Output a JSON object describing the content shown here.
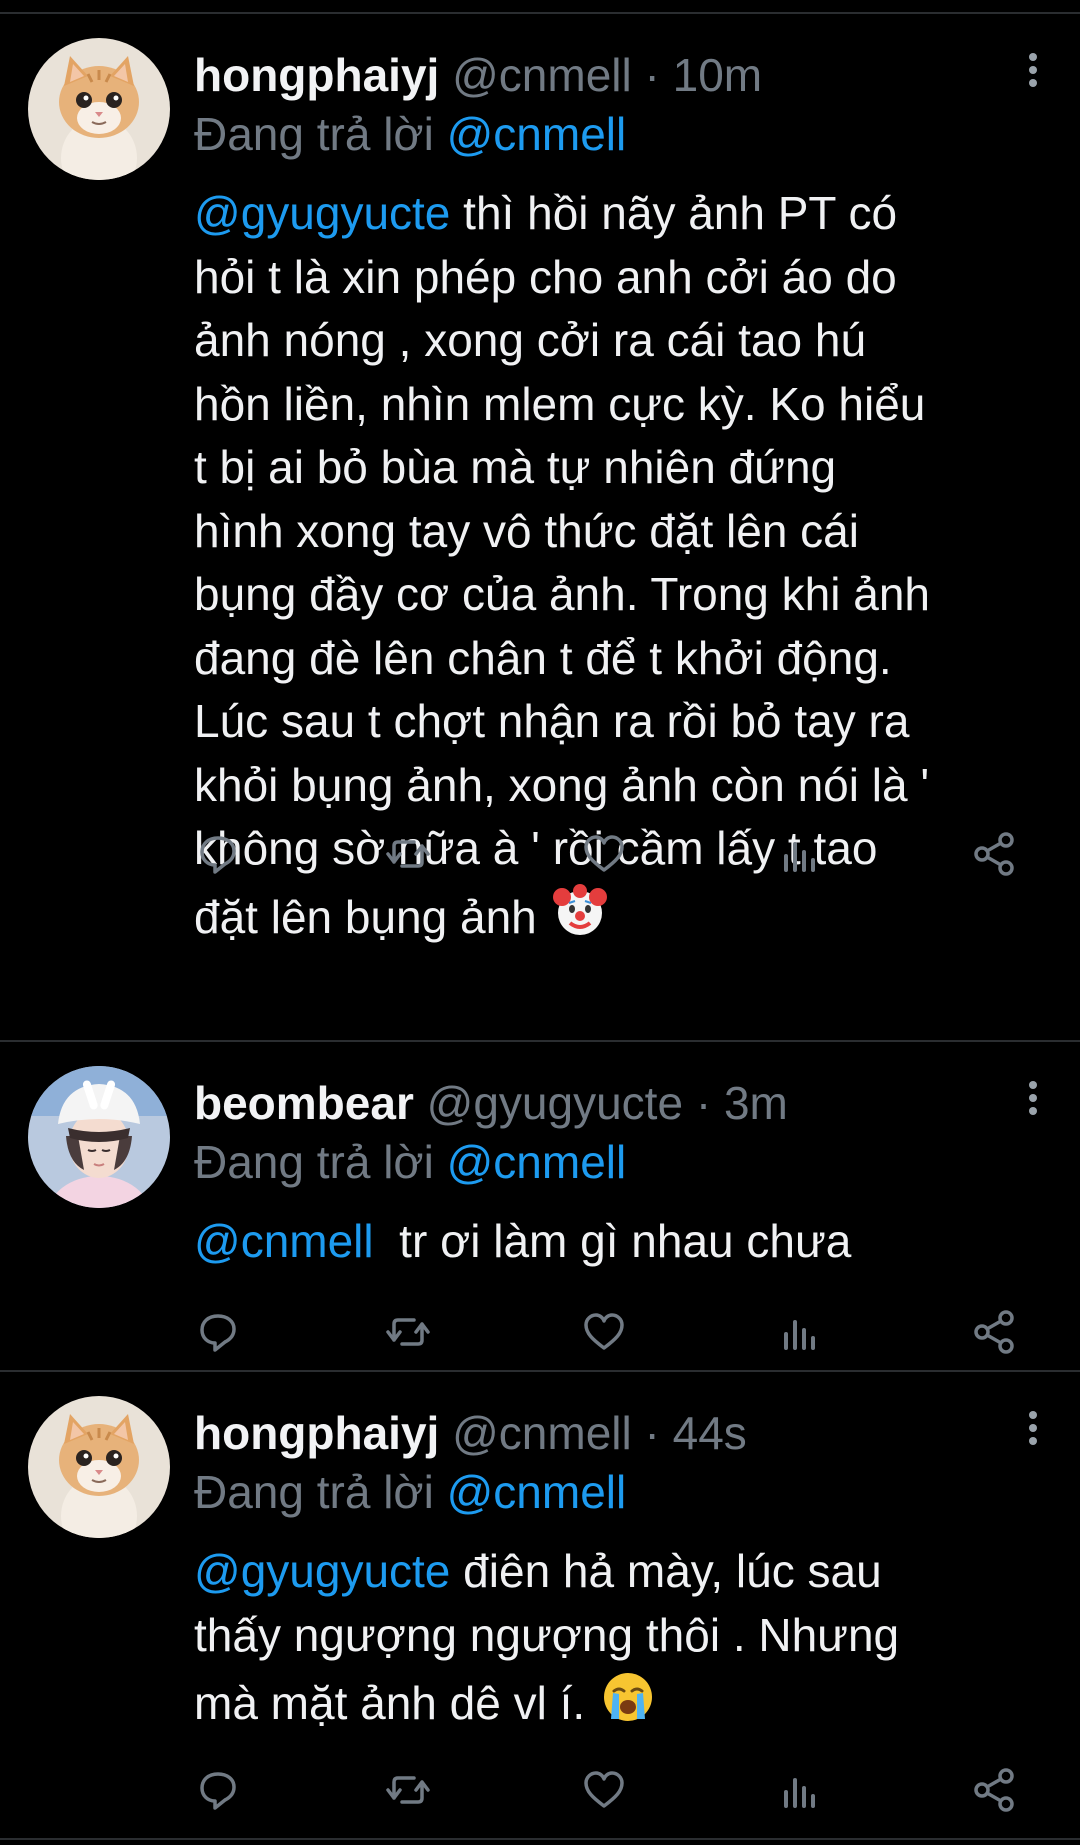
{
  "colors": {
    "background": "#000000",
    "text": "#e7e9ea",
    "secondary": "#717a84",
    "link": "#1d9bf0",
    "divider": "#2a2d30"
  },
  "reply_prefix": "Đang trả lời",
  "tweets": [
    {
      "display_name": "hongphaiyj",
      "handle": "@cnmell",
      "separator": "·",
      "time": "10m",
      "reply_to": "@cnmell",
      "mention": "@gyugyucte",
      "text_lines": [
        " thì hồi nãy ảnh PT có",
        "hỏi t là xin phép cho anh cởi áo do",
        "ảnh nóng , xong cởi ra cái tao hú",
        "hồn liền, nhìn mlem cực kỳ. Ko hiểu",
        "t bị ai bỏ bùa mà tự nhiên đứng",
        "hình xong tay vô thức đặt lên cái",
        "bụng đầy cơ của ảnh. Trong khi ảnh",
        "đang đè lên chân t để t khởi động.",
        "Lúc sau t chợt nhận ra rồi bỏ tay ra",
        "khỏi bụng ảnh, xong ảnh còn nói là '",
        "không sờ nữa à ' rồi cầm lấy t tao",
        "đặt lên bụng ảnh "
      ],
      "trailing_emoji": "clown-face-emoji",
      "avatar": "orange-kitten-avatar"
    },
    {
      "display_name": "beombear",
      "handle": "@gyugyucte",
      "separator": "·",
      "time": "3m",
      "reply_to": "@cnmell",
      "mention": "@cnmell",
      "text_lines": [
        "  tr ơi làm gì nhau chưa"
      ],
      "avatar": "person-in-white-hat-avatar"
    },
    {
      "display_name": "hongphaiyj",
      "handle": "@cnmell",
      "separator": "·",
      "time": "44s",
      "reply_to": "@cnmell",
      "mention": "@gyugyucte",
      "text_lines": [
        " điên hả mày, lúc sau",
        "thấy ngượng ngượng thôi . Nhưng",
        "mà mặt ảnh dê vl í. "
      ],
      "trailing_emoji": "loudly-crying-face-emoji",
      "avatar": "orange-kitten-avatar"
    }
  ],
  "action_icons": [
    "reply-icon",
    "retweet-icon",
    "like-icon",
    "views-icon",
    "share-icon"
  ]
}
